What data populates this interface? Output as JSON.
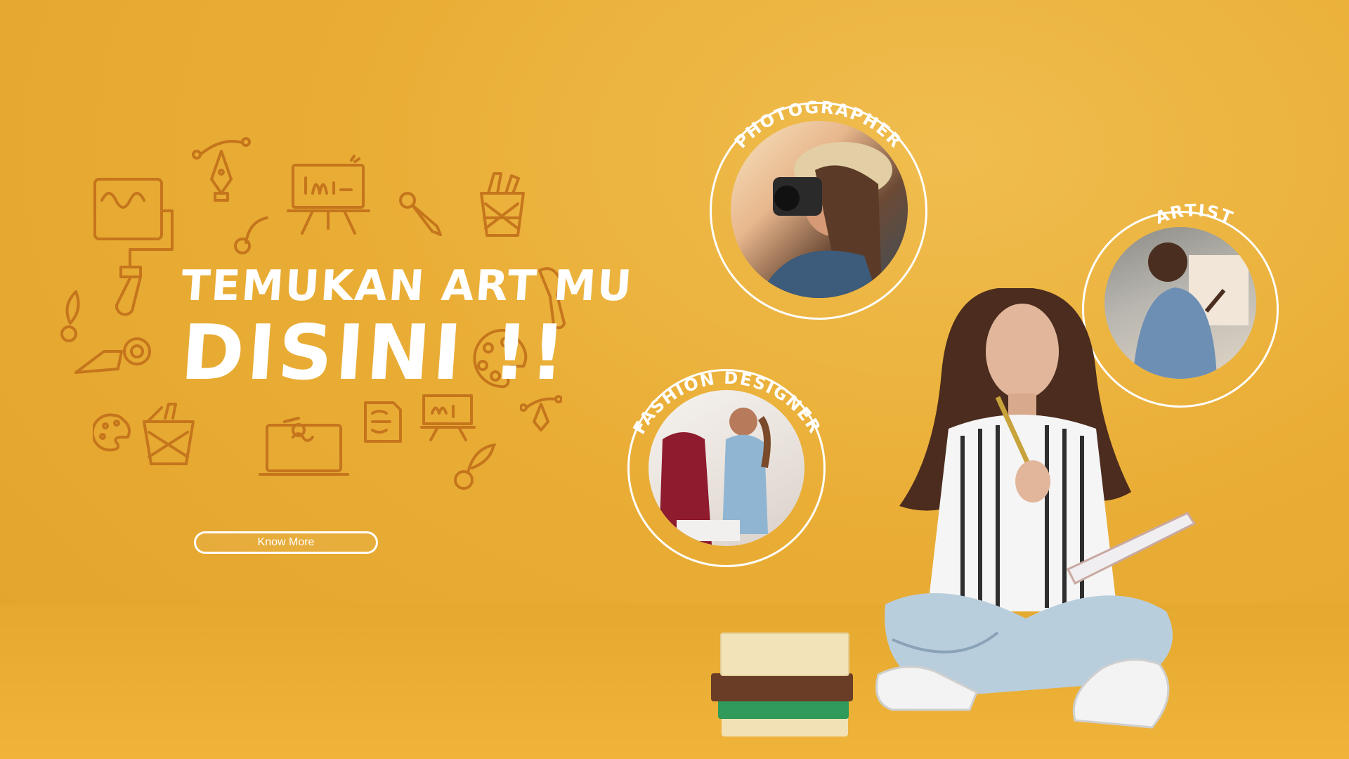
{
  "hero": {
    "headline_line1": "TEMUKAN ART MU",
    "headline_line2": "DISINI !!",
    "cta_label": "Know More"
  },
  "categories": [
    {
      "label": "PHOTOGRAPHER"
    },
    {
      "label": "ARTIST"
    },
    {
      "label": "FASHION DESIGNER"
    }
  ],
  "colors": {
    "background": "#e9ad35",
    "doodle": "#c2701a",
    "text": "#ffffff"
  }
}
